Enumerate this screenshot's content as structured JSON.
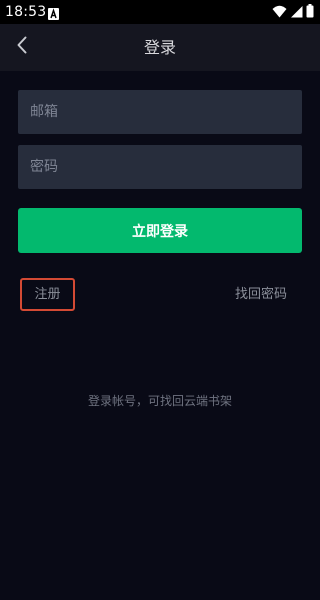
{
  "status_bar": {
    "time": "18:53",
    "icons": [
      "notification-a-icon",
      "wifi-icon",
      "signal-icon",
      "battery-icon"
    ]
  },
  "header": {
    "back_icon": "chevron-left-icon",
    "title": "登录"
  },
  "form": {
    "email_placeholder": "邮箱",
    "email_value": "",
    "password_placeholder": "密码",
    "password_value": "",
    "submit_label": "立即登录"
  },
  "links": {
    "register_label": "注册",
    "forgot_label": "找回密码"
  },
  "hint": "登录帐号，可找回云端书架",
  "colors": {
    "background": "#090a16",
    "header_background": "#151620",
    "field_background": "#272d3c",
    "primary_button": "#03b96e",
    "highlight_border": "#d44a34"
  }
}
